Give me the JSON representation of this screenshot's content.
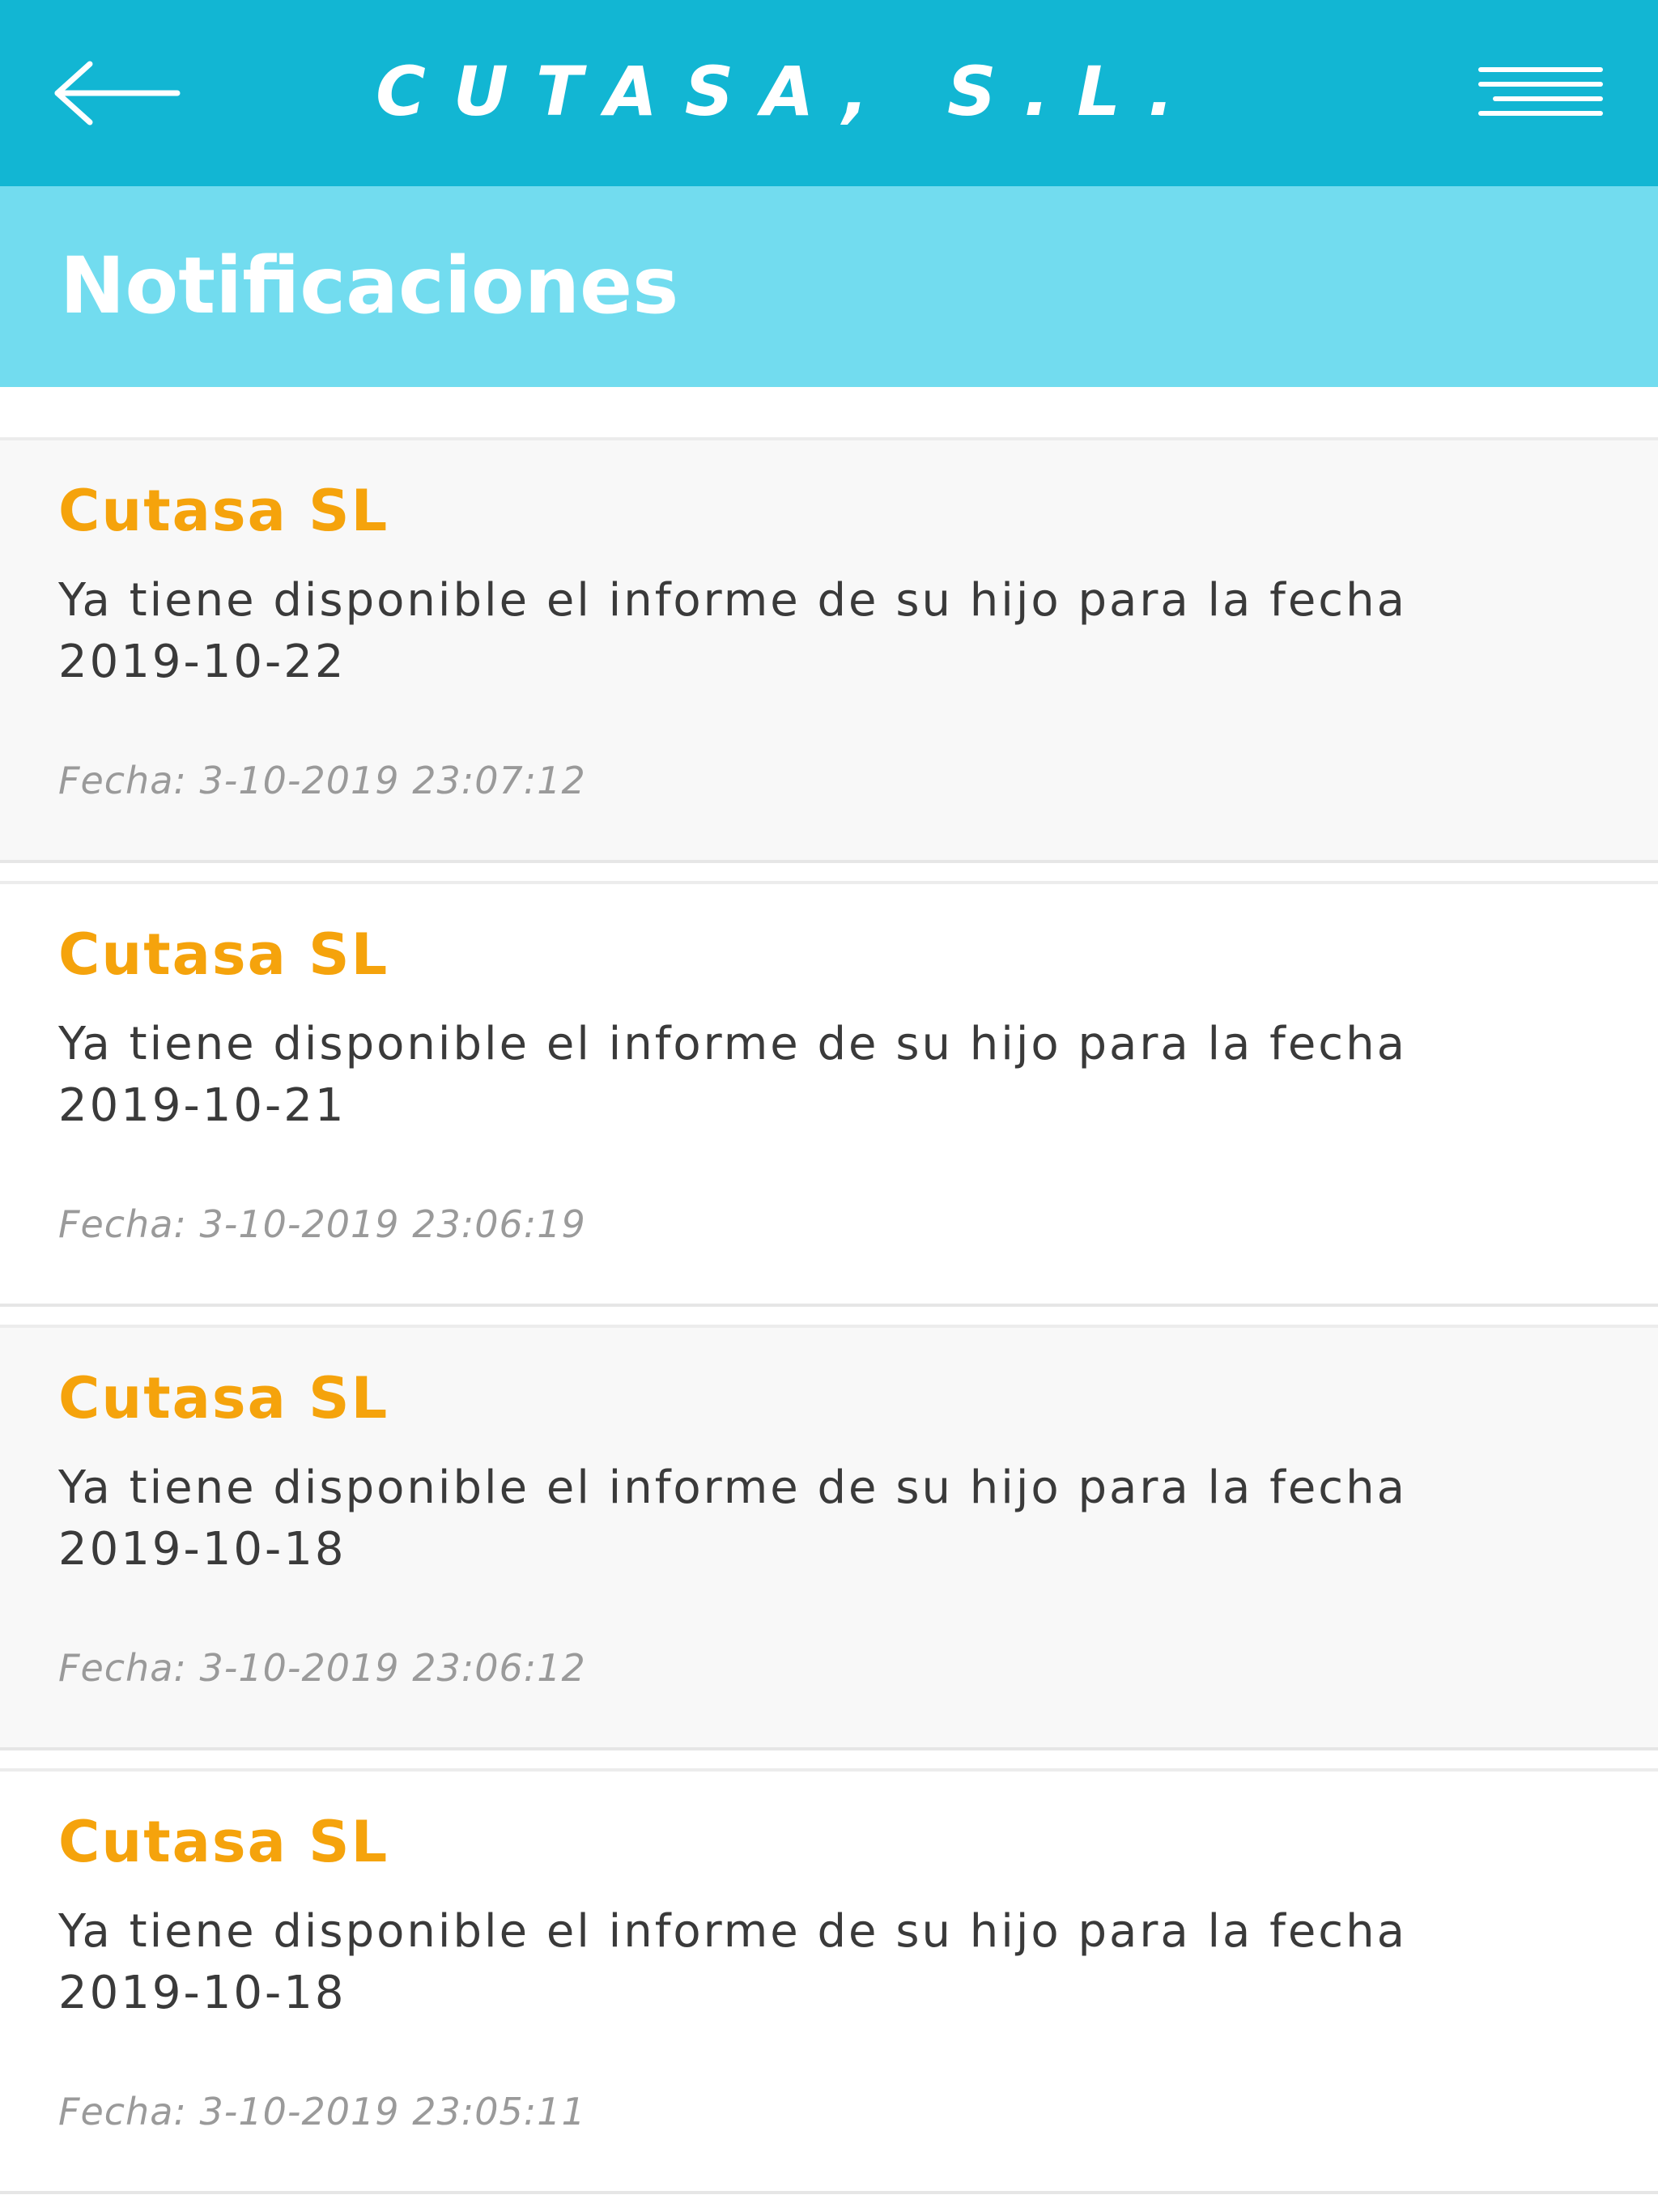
{
  "header": {
    "title": "CUTASA, S.L.",
    "back_icon": "arrow-left-icon",
    "menu_icon": "hamburger-menu-icon",
    "color": "#12b6d3"
  },
  "subheader": {
    "title": "Notificaciones",
    "color": "#72dcef"
  },
  "notifications": [
    {
      "sender": "Cutasa SL",
      "message": "Ya tiene disponible el informe de su hijo para la fecha 2019-10-22",
      "timestamp": "Fecha: 3-10-2019 23:07:12"
    },
    {
      "sender": "Cutasa SL",
      "message": "Ya tiene disponible el informe de su hijo para la fecha 2019-10-21",
      "timestamp": "Fecha: 3-10-2019 23:06:19"
    },
    {
      "sender": "Cutasa SL",
      "message": "Ya tiene disponible el informe de su hijo para la fecha 2019-10-18",
      "timestamp": "Fecha: 3-10-2019 23:06:12"
    },
    {
      "sender": "Cutasa SL",
      "message": "Ya tiene disponible el informe de su hijo para la fecha 2019-10-18",
      "timestamp": "Fecha: 3-10-2019 23:05:11"
    }
  ],
  "colors": {
    "sender": "#f5a30c",
    "message": "#3a3a3a",
    "timestamp": "#9a9a9a"
  }
}
